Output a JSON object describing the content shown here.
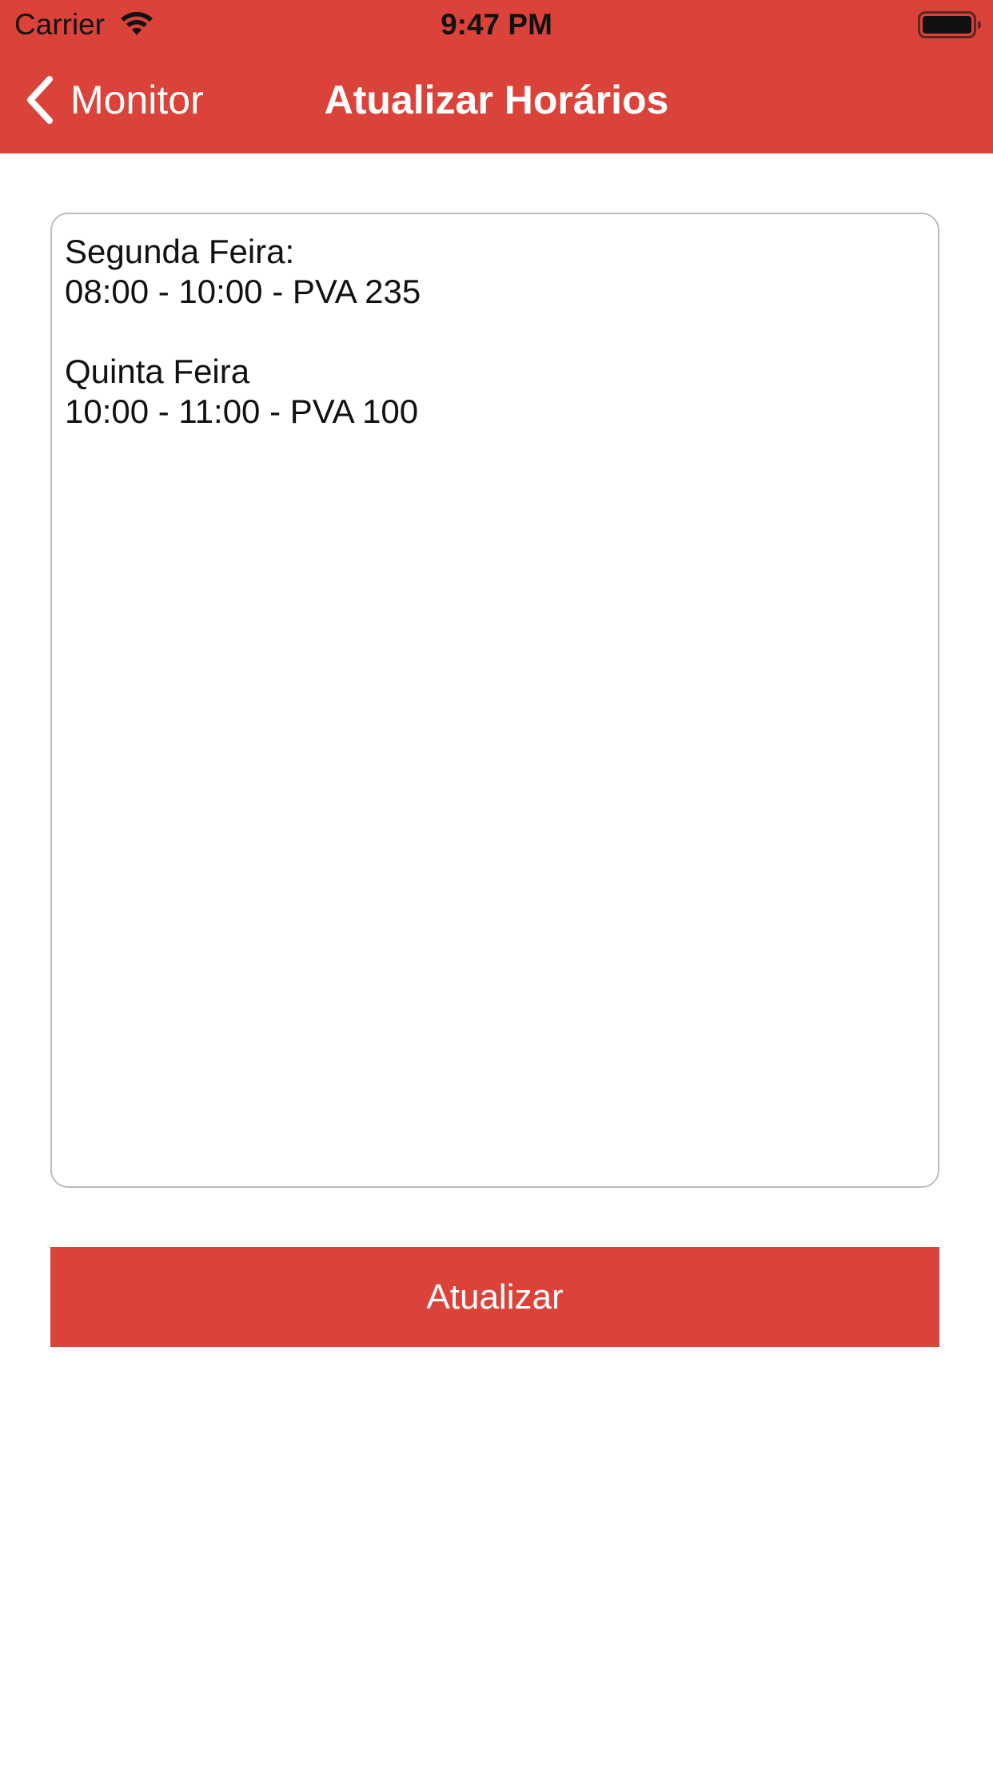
{
  "status_bar": {
    "carrier": "Carrier",
    "time": "9:47 PM",
    "wifi_icon": "wifi-icon",
    "battery_icon": "battery-icon"
  },
  "nav": {
    "back_label": "Monitor",
    "back_icon": "chevron-left-icon",
    "title": "Atualizar Horários"
  },
  "text_view": {
    "lines": [
      "Segunda Feira:",
      "08:00 - 10:00 - PVA 235",
      "",
      "Quinta Feira",
      "10:00 - 11:00 - PVA 100"
    ]
  },
  "button": {
    "label": "Atualizar"
  },
  "colors": {
    "accent": "#DB433A",
    "border": "#BDBDBD",
    "background": "#FFFFFF"
  }
}
